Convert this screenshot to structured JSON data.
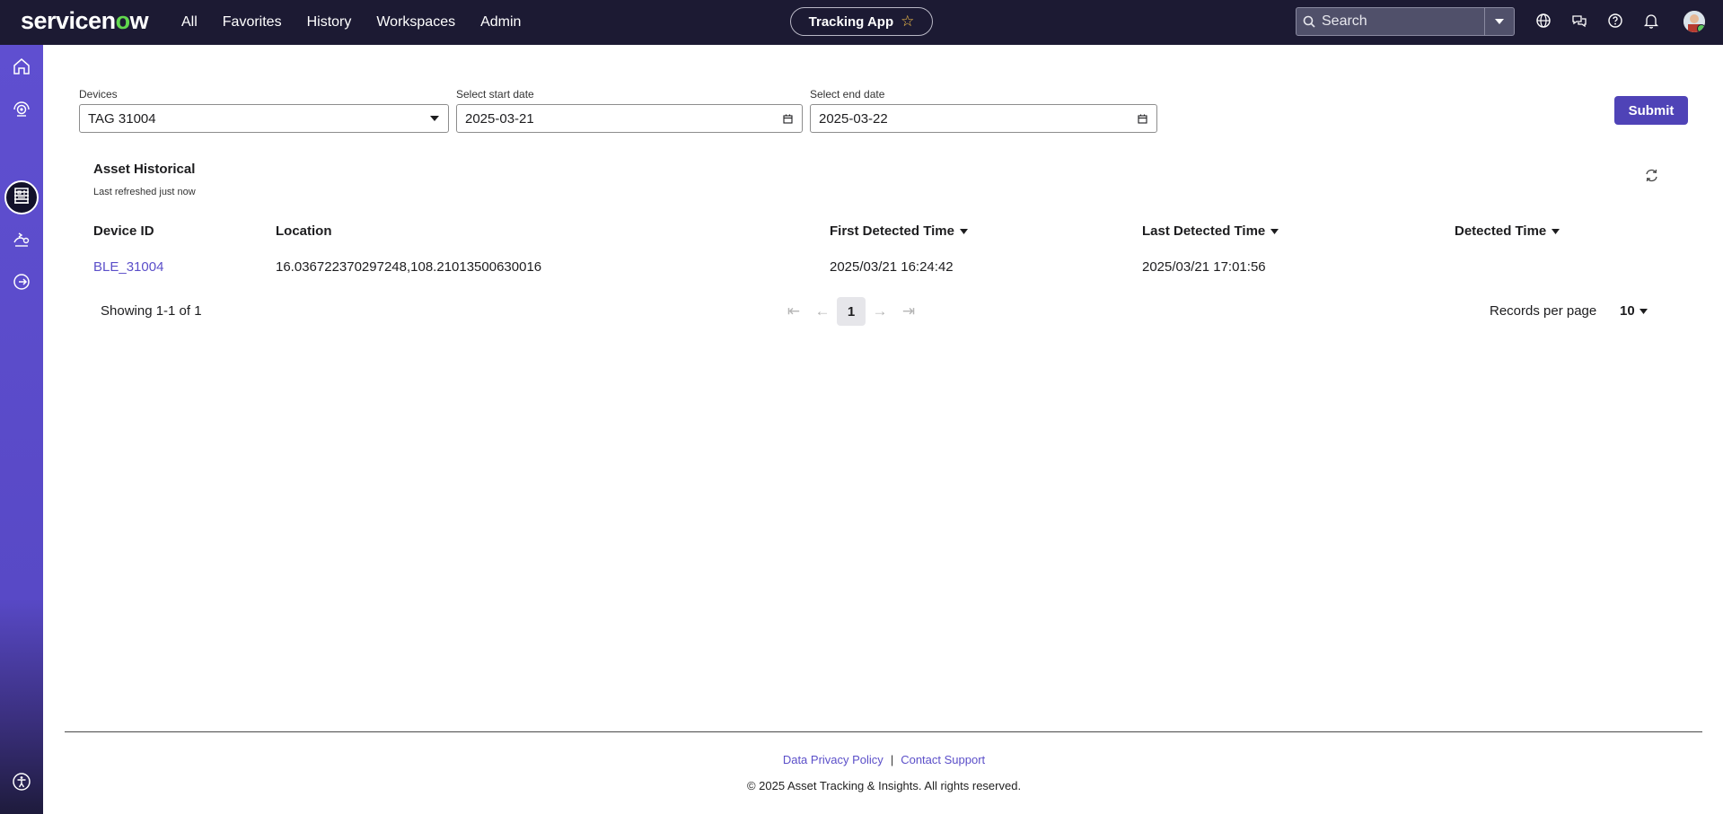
{
  "header": {
    "brand_prefix": "servicen",
    "brand_o": "o",
    "brand_suffix": "w",
    "nav": [
      "All",
      "Favorites",
      "History",
      "Workspaces",
      "Admin"
    ],
    "app_pill": "Tracking App",
    "search_placeholder": "Search",
    "icons": [
      "globe-icon",
      "chat-icon",
      "help-icon",
      "bell-icon",
      "avatar"
    ]
  },
  "sidebar": {
    "icons": [
      "home-icon",
      "agent-icon",
      "list-icon",
      "building-icon",
      "route-icon",
      "logout-icon",
      "accessibility-icon"
    ],
    "active": "list-icon"
  },
  "form": {
    "devices_label": "Devices",
    "devices_value": "TAG 31004",
    "start_label": "Select start date",
    "start_value": "2025-03-21",
    "end_label": "Select end date",
    "end_value": "2025-03-22",
    "submit_label": "Submit"
  },
  "table": {
    "title": "Asset Historical",
    "subtitle": "Last refreshed just now",
    "columns": [
      "Device ID",
      "Location",
      "First Detected Time",
      "Last Detected Time",
      "Detected Time"
    ],
    "rows": [
      {
        "device_id": "BLE_31004",
        "location": "16.036722370297248,108.21013500630016",
        "first_detected": "2025/03/21 16:24:42",
        "last_detected": "2025/03/21 17:01:56",
        "detected": ""
      }
    ]
  },
  "pagination": {
    "showing": "Showing 1-1 of 1",
    "current_page": "1",
    "records_label": "Records per page",
    "records_value": "10"
  },
  "footer": {
    "privacy_link": "Data Privacy Policy",
    "separator": "|",
    "support_link": "Contact Support",
    "copyright": "© 2025 Asset Tracking & Insights. All rights reserved."
  },
  "colors": {
    "topbar": "#1c1a33",
    "accent": "#4f43b7",
    "link": "#5b4fc9",
    "brand_green": "#62d84e"
  }
}
